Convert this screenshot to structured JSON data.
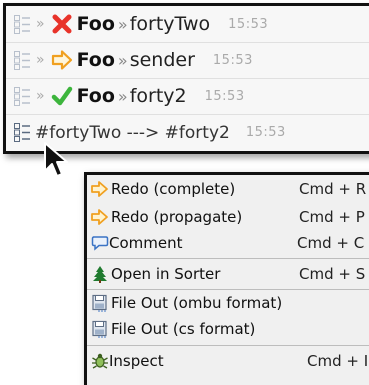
{
  "changes": [
    {
      "mark": "cross-icon",
      "class_name": "Foo",
      "separator": "»",
      "selector": "fortyTwo",
      "time": "15:53"
    },
    {
      "mark": "arrow-icon",
      "class_name": "Foo",
      "separator": "»",
      "selector": "sender",
      "time": "15:53"
    },
    {
      "mark": "check-icon",
      "class_name": "Foo",
      "separator": "»",
      "selector": "forty2",
      "time": "15:53"
    }
  ],
  "row_prefix": "»",
  "rename": {
    "text": "#fortyTwo ---> #forty2",
    "time": "15:53"
  },
  "menu": [
    {
      "label": "Redo (complete)",
      "shortcut": "Cmd + R",
      "icon": "redo-arrow-icon"
    },
    {
      "label": "Redo (propagate)",
      "shortcut": "Cmd + P",
      "icon": "redo-arrow-icon"
    },
    {
      "label": "Comment",
      "shortcut": "Cmd + C",
      "icon": "comment-bubble-icon"
    },
    {
      "label": "Open in Sorter",
      "shortcut": "Cmd + S",
      "icon": "tree-icon"
    },
    {
      "label": "File Out (ombu format)",
      "shortcut": "",
      "icon": "floppy-disk-icon"
    },
    {
      "label": "File Out (cs format)",
      "shortcut": "",
      "icon": "floppy-disk-icon"
    },
    {
      "label": "Inspect",
      "shortcut": "Cmd + I",
      "icon": "inspect-bug-icon"
    }
  ],
  "colors": {
    "cross": "#e8332a",
    "arrow": "#f0a020",
    "check": "#3db53d",
    "tree": "#1f7a2e",
    "accent": "#3a73c4"
  }
}
